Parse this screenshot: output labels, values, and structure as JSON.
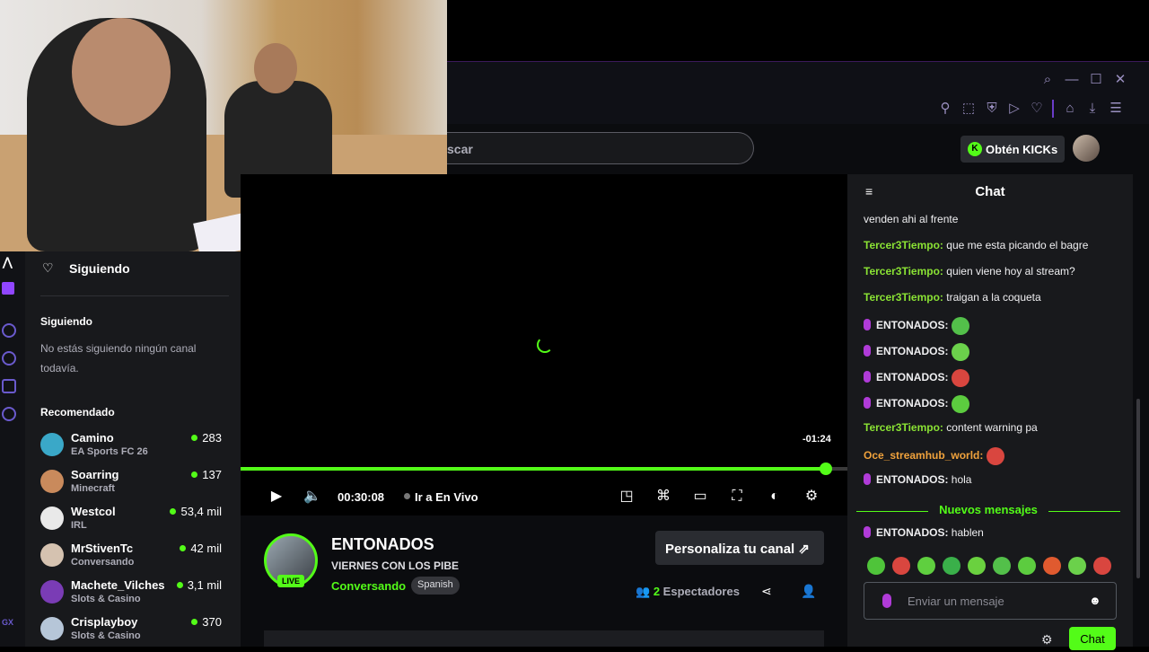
{
  "topbar": {
    "icons": [
      "search-icon",
      "minimize-icon",
      "maximize-icon",
      "close-icon",
      "pin-icon",
      "crop-icon",
      "shield-icon",
      "play-icon",
      "heart-icon",
      "cube-icon",
      "download-icon",
      "menu-icon"
    ]
  },
  "nav": {
    "search_fragment": "scar",
    "kicks_label": "Obtén KICKs"
  },
  "sidebar": {
    "following_header": "Siguiendo",
    "following_section": "Siguiendo",
    "empty_text": "No estás siguiendo ningún canal todavía.",
    "recommended_header": "Recomendado",
    "channels": [
      {
        "name": "Camino",
        "category": "EA Sports FC 26",
        "viewers": "283",
        "color": "#3aa8c8"
      },
      {
        "name": "Soarring",
        "category": "Minecraft",
        "viewers": "137",
        "color": "#c98a5c"
      },
      {
        "name": "Westcol",
        "category": "IRL",
        "viewers": "53,4 mil",
        "color": "#e9e9e9"
      },
      {
        "name": "MrStivenTc",
        "category": "Conversando",
        "viewers": "42 mil",
        "color": "#d5c2b0"
      },
      {
        "name": "Machete_Vilches",
        "category": "Slots & Casino",
        "viewers": "3,1 mil",
        "color": "#7a3cb5"
      },
      {
        "name": "Crisplayboy",
        "category": "Slots & Casino",
        "viewers": "370",
        "color": "#b6c6d8"
      }
    ],
    "gx_label": "GX"
  },
  "player": {
    "remaining": "-01:24",
    "time": "00:30:08",
    "go_live": "Ir a En Vivo",
    "progress": 0.965
  },
  "channel": {
    "name": "ENTONADOS",
    "title": "VIERNES CON LOS PIBE",
    "category": "Conversando",
    "language": "Spanish",
    "live_badge": "LIVE",
    "customize_label": "Personaliza tu canal",
    "viewers_count": "2",
    "viewers_label": "Espectadores"
  },
  "chat": {
    "title": "Chat",
    "messages": [
      {
        "user": "",
        "text": "venden ahi al frente",
        "color": "#efeff1"
      },
      {
        "user": "Tercer3Tiempo:",
        "text": "que me esta picando el bagre",
        "color": "#8ae234"
      },
      {
        "user": "Tercer3Tiempo:",
        "text": "quien viene hoy al stream?",
        "color": "#8ae234"
      },
      {
        "user": "Tercer3Tiempo:",
        "text": "traigan a la coqueta",
        "color": "#8ae234"
      },
      {
        "user": "ENTONADOS:",
        "text": "",
        "color": "#efeff1",
        "emote": "#53c04a"
      },
      {
        "user": "ENTONADOS:",
        "text": "",
        "color": "#efeff1",
        "emote": "#6bd14b"
      },
      {
        "user": "ENTONADOS:",
        "text": "",
        "color": "#efeff1",
        "emote": "#d9463f"
      },
      {
        "user": "ENTONADOS:",
        "text": "",
        "color": "#efeff1",
        "emote": "#5ccc3f"
      },
      {
        "user": "Tercer3Tiempo:",
        "text": "content warning pa",
        "color": "#8ae234"
      },
      {
        "user": "Oce_streamhub_world:",
        "text": "",
        "color": "#f0a23c",
        "emote": "#d9463f"
      },
      {
        "user": "ENTONADOS:",
        "text": "hola",
        "color": "#efeff1"
      }
    ],
    "new_messages": "Nuevos mensajes",
    "after_messages": [
      {
        "user": "ENTONADOS:",
        "text": "hablen",
        "color": "#efeff1"
      }
    ],
    "input_placeholder": "Enviar un mensaje",
    "send_label": "Chat"
  }
}
